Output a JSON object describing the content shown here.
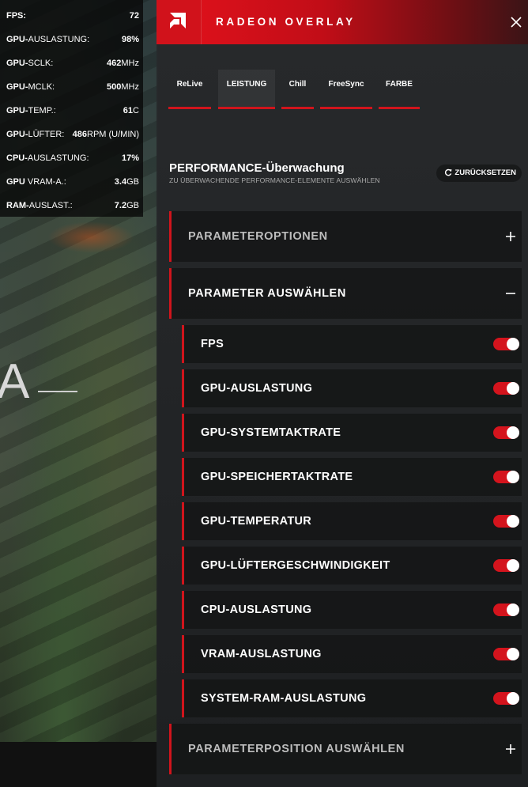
{
  "hud": {
    "rows": [
      {
        "label": "FPS:",
        "label_light": "",
        "value": "72",
        "unit": ""
      },
      {
        "label": "GPU-",
        "label_light": "AUSLASTUNG:",
        "value": "98%",
        "unit": ""
      },
      {
        "label": "GPU-",
        "label_light": "SCLK:",
        "value": "462",
        "unit": "MHz"
      },
      {
        "label": "GPU-",
        "label_light": "MCLK:",
        "value": "500",
        "unit": "MHz"
      },
      {
        "label": "GPU-",
        "label_light": "TEMP.:",
        "value": "61",
        "unit": "C"
      },
      {
        "label": "GPU-",
        "label_light": "LÜFTER:",
        "value": "486",
        "unit": "RPM (U/MIN)"
      },
      {
        "label": "CPU-",
        "label_light": "AUSLASTUNG:",
        "value": "17%",
        "unit": ""
      },
      {
        "label": "GPU ",
        "label_light": "VRAM-A.:",
        "value": "3.4",
        "unit": "GB"
      },
      {
        "label": "RAM-",
        "label_light": "AUSLAST.:",
        "value": "7.2",
        "unit": "GB"
      }
    ]
  },
  "game": {
    "letter": "A"
  },
  "header": {
    "title": "RADEON OVERLAY",
    "logo_icon": "amd-logo-icon",
    "close_icon": "close-icon"
  },
  "tabs": [
    {
      "label": "ReLive",
      "active": false
    },
    {
      "label": "LEISTUNG",
      "active": true
    },
    {
      "label": "Chill",
      "active": false
    },
    {
      "label": "FreeSync",
      "active": false
    },
    {
      "label": "FARBE",
      "active": false
    }
  ],
  "section": {
    "title": "PERFORMANCE-Überwachung",
    "subtitle": "ZU ÜBERWACHENDE PERFORMANCE-ELEMENTE AUSWÄHLEN",
    "reset_label": "ZURÜCKSETZEN",
    "reset_icon": "refresh-icon"
  },
  "accordions": {
    "options": {
      "label": "PARAMETEROPTIONEN",
      "expanded": false,
      "icon": "plus-icon"
    },
    "select": {
      "label": "PARAMETER AUSWÄHLEN",
      "expanded": true,
      "icon": "minus-icon"
    },
    "position": {
      "label": "PARAMETERPOSITION AUSWÄHLEN",
      "expanded": false,
      "icon": "plus-icon"
    }
  },
  "parameters": [
    {
      "label": "FPS",
      "enabled": true
    },
    {
      "label": "GPU-AUSLASTUNG",
      "enabled": true
    },
    {
      "label": "GPU-SYSTEMTAKTRATE",
      "enabled": true
    },
    {
      "label": "GPU-SPEICHERTAKTRATE",
      "enabled": true
    },
    {
      "label": "GPU-TEMPERATUR",
      "enabled": true
    },
    {
      "label": "GPU-LÜFTERGESCHWINDIGKEIT",
      "enabled": true
    },
    {
      "label": "CPU-AUSLASTUNG",
      "enabled": true
    },
    {
      "label": "VRAM-AUSLASTUNG",
      "enabled": true
    },
    {
      "label": "SYSTEM-RAM-AUSLASTUNG",
      "enabled": true
    }
  ],
  "colors": {
    "accent": "#d0141c",
    "toggle_on": "#d4141d"
  }
}
